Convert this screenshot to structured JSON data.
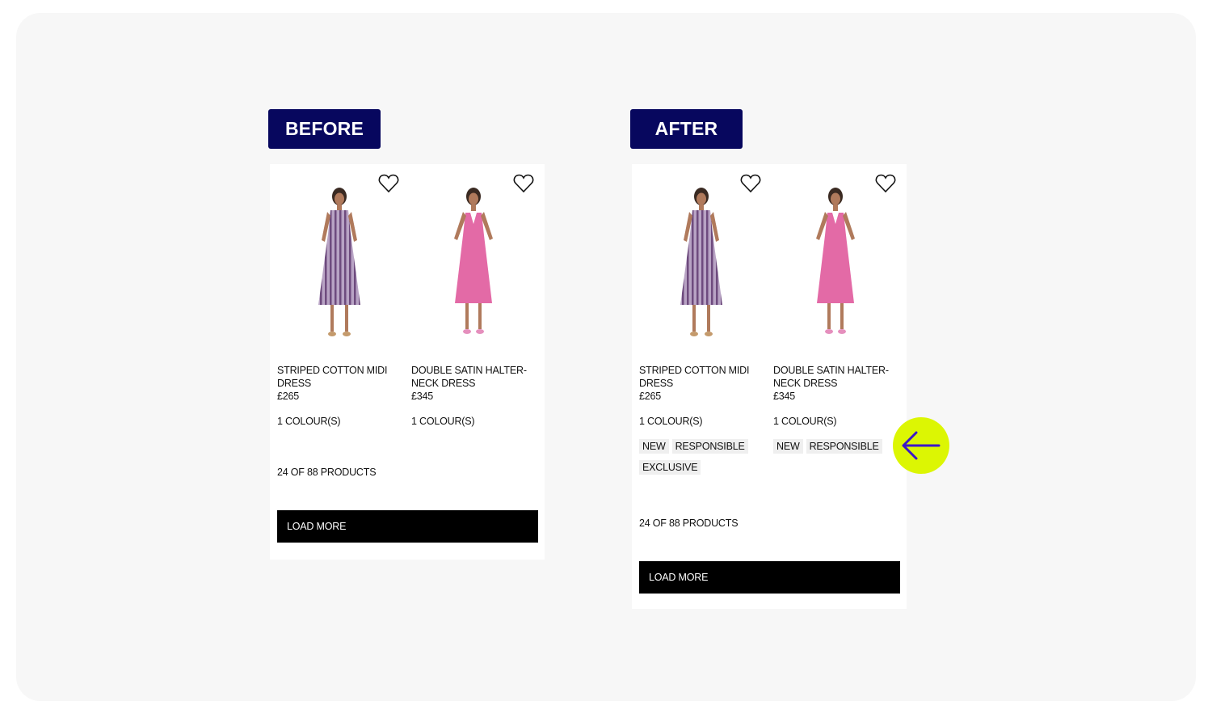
{
  "labels": {
    "before": "BEFORE",
    "after": "AFTER"
  },
  "colors": {
    "tag_bg": "#07075e",
    "accent_circle": "#dcf603",
    "arrow": "#3b16c9"
  },
  "before": {
    "products": [
      {
        "name": "STRIPED COTTON MIDI DRESS",
        "price": "£265",
        "colours": "1 COLOUR(S)",
        "icon": "heart-icon"
      },
      {
        "name": "DOUBLE SATIN HALTER-NECK DRESS",
        "price": "£345",
        "colours": "1 COLOUR(S)",
        "icon": "heart-icon"
      }
    ],
    "count": "24 OF 88 PRODUCTS",
    "load_more": "LOAD MORE"
  },
  "after": {
    "products": [
      {
        "name": "STRIPED COTTON MIDI DRESS",
        "price": "£265",
        "colours": "1 COLOUR(S)",
        "badges": [
          "NEW",
          "RESPONSIBLE",
          "EXCLUSIVE"
        ],
        "icon": "heart-icon"
      },
      {
        "name": "DOUBLE SATIN HALTER-NECK DRESS",
        "price": "£345",
        "colours": "1 COLOUR(S)",
        "badges": [
          "NEW",
          "RESPONSIBLE"
        ],
        "icon": "heart-icon"
      }
    ],
    "count": "24 OF 88 PRODUCTS",
    "load_more": "LOAD MORE"
  },
  "annotation": {
    "icon": "arrow-left-icon"
  }
}
